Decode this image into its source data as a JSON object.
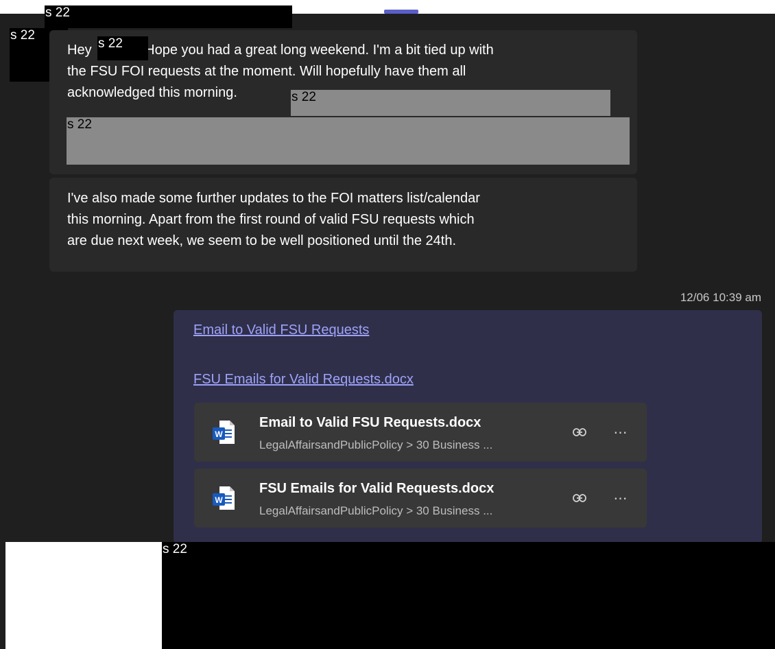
{
  "redaction_label": "s 22",
  "messages": {
    "received": [
      {
        "lines": [
          {
            "before": "Hey",
            "after": " Hope you had a great long weekend. I'm a bit tied up with"
          },
          {
            "text": "the FSU FOI requests at the moment. Will hopefully have them all"
          },
          {
            "text": "acknowledged this morning."
          }
        ]
      },
      {
        "lines": [
          {
            "text": "I've also  made some further updates to the FOI matters list/calendar"
          },
          {
            "text": "this morning. Apart from the first round of valid FSU requests which"
          },
          {
            "text": "are due next week, we seem to be well positioned until the 24th."
          }
        ]
      }
    ],
    "sent": {
      "timestamp": "12/06 10:39 am",
      "links": [
        "Email to Valid FSU Requests",
        "FSU Emails for Valid Requests.docx"
      ],
      "attachments": [
        {
          "name": "Email to Valid FSU Requests.docx",
          "path": "LegalAffairsandPublicPolicy > 30 Business ...",
          "icon": "word-document-icon"
        },
        {
          "name": "FSU Emails for Valid Requests.docx",
          "path": "LegalAffairsandPublicPolicy > 30 Business ...",
          "icon": "word-document-icon"
        }
      ]
    }
  },
  "colors": {
    "background": "#1f1f1f",
    "bubble_received": "#292929",
    "bubble_sent": "#2f2f4a",
    "link": "#9ea2f8",
    "word_blue": "#185abd"
  }
}
